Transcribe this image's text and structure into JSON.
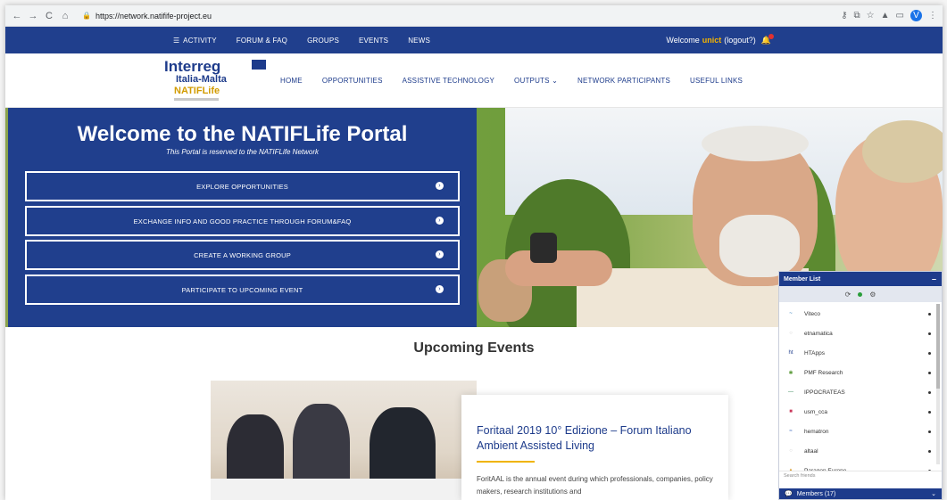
{
  "browser": {
    "url": "https://network.natifife-project.eu",
    "back": "←",
    "forward": "→",
    "reload": "C",
    "home": "⌂",
    "lock": "🔒",
    "profile_initial": "V"
  },
  "topnav": {
    "items": [
      "ACTIVITY",
      "FORUM & FAQ",
      "GROUPS",
      "EVENTS",
      "NEWS"
    ],
    "welcome": "Welcome",
    "username": "unict",
    "logout": "(logout?)"
  },
  "logo": {
    "line1": "Interreg",
    "line2": "Italia-Malta",
    "line3": "NATIFLife"
  },
  "mainnav": {
    "items": [
      "HOME",
      "OPPORTUNITIES",
      "ASSISTIVE TECHNOLOGY",
      "OUTPUTS ⌄",
      "NETWORK PARTICIPANTS",
      "USEFUL LINKS"
    ]
  },
  "hero": {
    "title": "Welcome to the NATIFLife Portal",
    "subtitle": "This Portal is reserved to the NATIFLife Network",
    "buttons": [
      "EXPLORE OPPORTUNITIES",
      "EXCHANGE INFO AND GOOD PRACTICE THROUGH FORUM&FAQ",
      "CREATE A WORKING GROUP",
      "PARTICIPATE TO UPCOMING EVENT"
    ]
  },
  "events": {
    "heading": "Upcoming Events",
    "card_title": "Foritaal 2019 10° Edizione – Forum Italiano Ambient Assisted Living",
    "card_desc": "ForitAAL is the annual event during which professionals, companies, policy makers, research institutions and"
  },
  "members": {
    "title": "Member List",
    "minimize": "–",
    "list": [
      {
        "name": "Viteco",
        "avatar": "~",
        "color": "#2e7bb8"
      },
      {
        "name": "etnamatica",
        "avatar": "○",
        "color": "#cfcfcf"
      },
      {
        "name": "HTApps",
        "avatar": "ht",
        "color": "#1d3b8b"
      },
      {
        "name": "PMF Research",
        "avatar": "✱",
        "color": "#5b9b3a"
      },
      {
        "name": "IPPOCRATEAS",
        "avatar": "—",
        "color": "#3a8a5a"
      },
      {
        "name": "usm_cca",
        "avatar": "■",
        "color": "#c9365a"
      },
      {
        "name": "hematron",
        "avatar": "≈",
        "color": "#4a73c0"
      },
      {
        "name": "altaal",
        "avatar": "○",
        "color": "#cfcfcf"
      },
      {
        "name": "Paragon Europe",
        "avatar": "▲",
        "color": "#d79a2a"
      }
    ],
    "search_placeholder": "Search friends",
    "footer": "Members (17)",
    "footer_chevron": "⌄"
  }
}
